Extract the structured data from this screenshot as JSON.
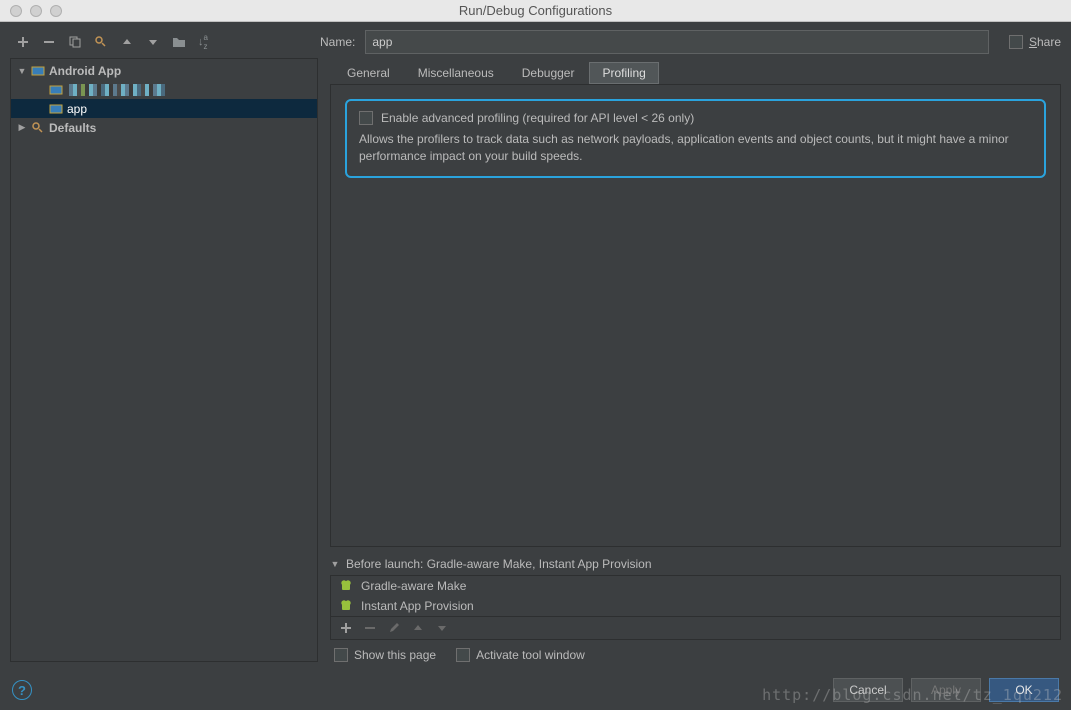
{
  "window": {
    "title": "Run/Debug Configurations"
  },
  "nameRow": {
    "label": "Name:",
    "value": "app",
    "share_label": "Share"
  },
  "sidebar": {
    "nodes": [
      {
        "label": "Android App",
        "bold": true
      },
      {
        "label": "app",
        "selected": true
      },
      {
        "label": "Defaults",
        "bold": true
      }
    ]
  },
  "tabs": {
    "items": [
      {
        "label": "General"
      },
      {
        "label": "Miscellaneous"
      },
      {
        "label": "Debugger"
      },
      {
        "label": "Profiling",
        "active": true
      }
    ]
  },
  "profiling": {
    "checkbox_label": "Enable advanced profiling (required for API level < 26 only)",
    "desc": "Allows the profilers to track data such as network payloads, application events and object counts, but it might have a minor performance impact on your build speeds."
  },
  "beforeLaunch": {
    "header": "Before launch: Gradle-aware Make, Instant App Provision",
    "items": [
      {
        "label": "Gradle-aware Make"
      },
      {
        "label": "Instant App Provision"
      }
    ],
    "opt_show_page": "Show this page",
    "opt_activate_window": "Activate tool window"
  },
  "footer": {
    "cancel": "Cancel",
    "apply": "Apply",
    "ok": "OK"
  },
  "watermark": "http://blog.csdn.net/tz_1qu212"
}
